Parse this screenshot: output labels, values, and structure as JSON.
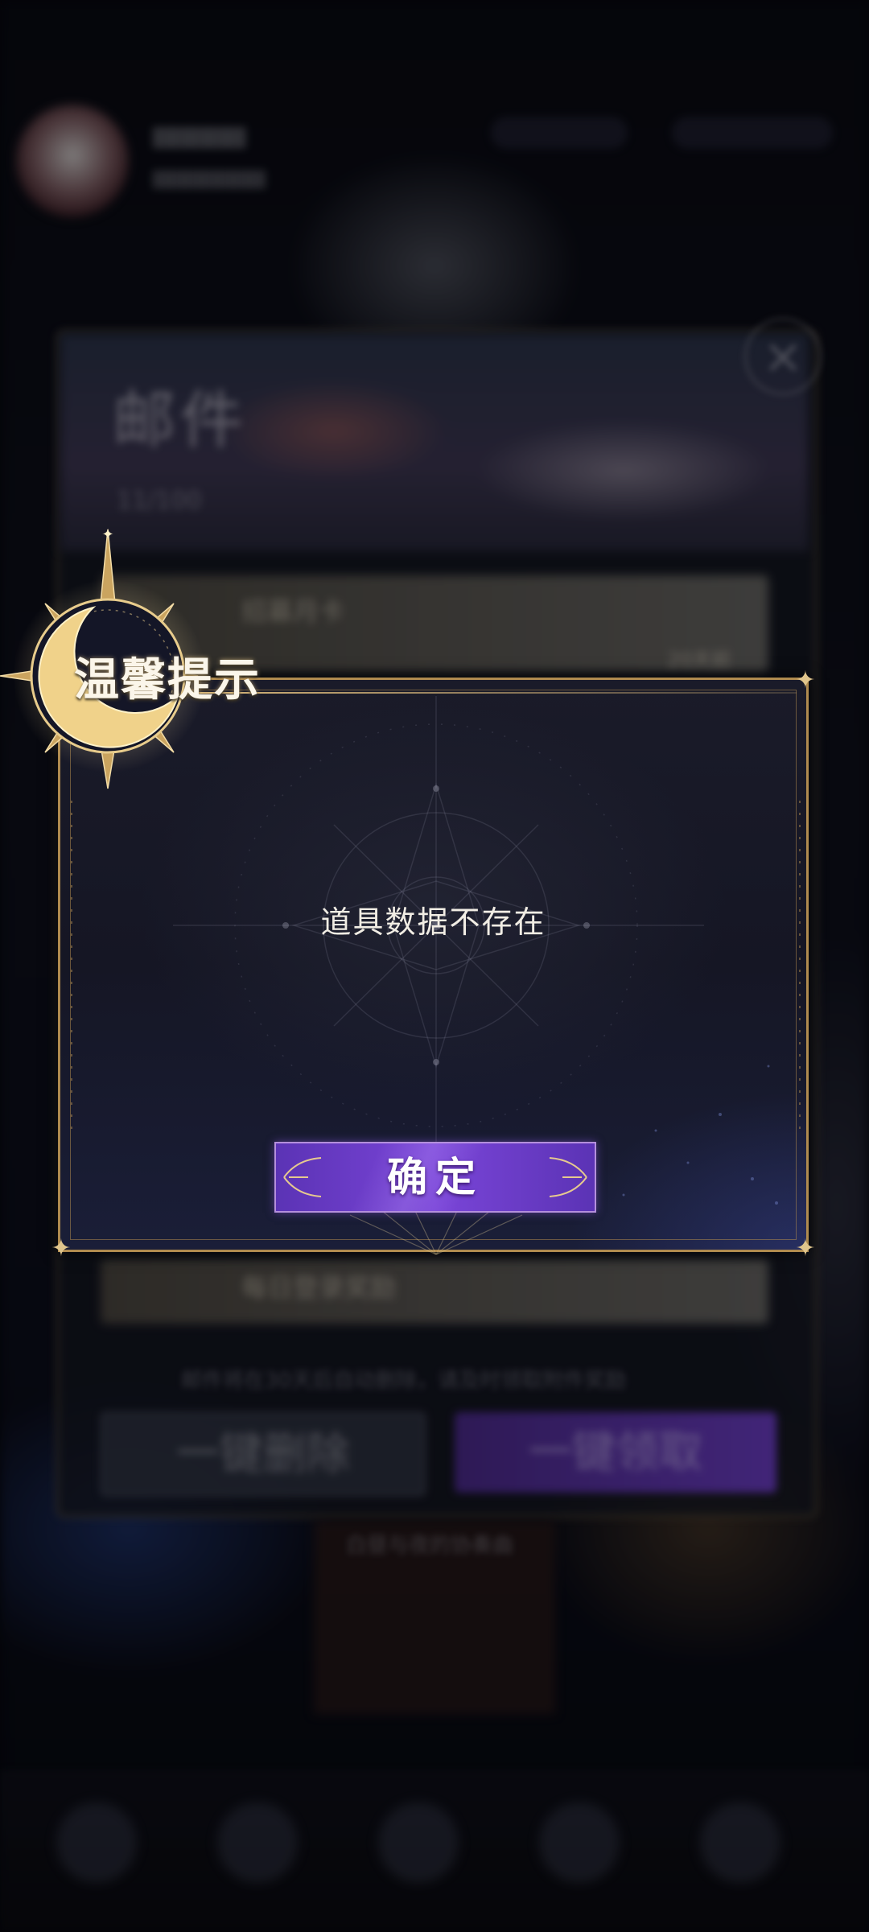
{
  "background": {
    "mail_title": "邮件",
    "mail_count": "11/100",
    "mail_items": [
      {
        "label": "招募月卡",
        "meta": "20天前"
      },
      {
        "label": "每日登录奖励",
        "meta": ""
      }
    ],
    "mail_hint": "邮件将在30天后自动删除，请及时领取附件奖励",
    "delete_all_label": "一键删除",
    "collect_all_label": "一键领取",
    "event_label": "白昼与夜的协奏曲",
    "close_icon": "close-icon"
  },
  "dialog": {
    "title": "温馨提示",
    "message": "道具数据不存在",
    "confirm_label": "确定",
    "emblem_icon": "crescent-moon-compass-icon"
  },
  "colors": {
    "frame_gold": "#b08b4f",
    "button_purple": "#6a3cc2",
    "dialog_bg": "#151624",
    "text_light": "#f1ede4"
  }
}
